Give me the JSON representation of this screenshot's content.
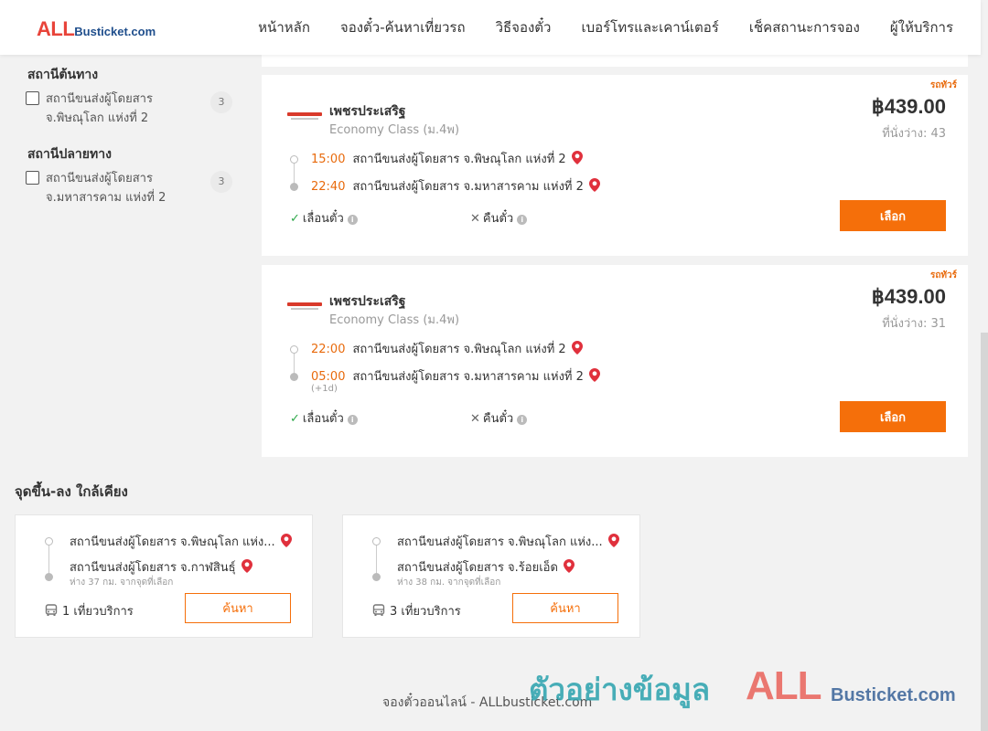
{
  "header": {
    "logo_all": "ALL",
    "logo_rest": "Busticket.com",
    "nav": [
      "หน้าหลัก",
      "จองตั๋ว-ค้นหาเที่ยวรถ",
      "วิธีจองตั๋ว",
      "เบอร์โทรและเคาน์เตอร์",
      "เช็คสถานะการจอง",
      "ผู้ให้บริการ"
    ]
  },
  "filters": {
    "origin_title": "สถานีต้นทาง",
    "origin_item": {
      "label": "สถานีขนส่งผู้โดยสาร จ.พิษณุโลก แห่งที่ 2",
      "count": "3"
    },
    "dest_title": "สถานีปลายทาง",
    "dest_item": {
      "label": "สถานีขนส่งผู้โดยสาร จ.มหาสารคาม แห่งที่ 2",
      "count": "3"
    }
  },
  "trips": [
    {
      "tag": "รถทัวร์",
      "operator": "เพชรประเสริฐ",
      "class": "Economy Class (ม.4พ)",
      "price": "฿439.00",
      "seats": "ที่นั่งว่าง: 43",
      "depart_time": "15:00",
      "depart_station": "สถานีขนส่งผู้โดยสาร จ.พิษณุโลก แห่งที่ 2",
      "arrive_time": "22:40",
      "arrive_station": "สถานีขนส่งผู้โดยสาร จ.มหาสารคาม แห่งที่ 2",
      "arrive_note": "",
      "feature_ok": "เลื่อนตั๋ว",
      "feature_no": "คืนตั๋ว",
      "button": "เลือก"
    },
    {
      "tag": "รถทัวร์",
      "operator": "เพชรประเสริฐ",
      "class": "Economy Class (ม.4พ)",
      "price": "฿439.00",
      "seats": "ที่นั่งว่าง: 31",
      "depart_time": "22:00",
      "depart_station": "สถานีขนส่งผู้โดยสาร จ.พิษณุโลก แห่งที่ 2",
      "arrive_time": "05:00",
      "arrive_station": "สถานีขนส่งผู้โดยสาร จ.มหาสารคาม แห่งที่ 2",
      "arrive_note": "(+1d)",
      "feature_ok": "เลื่อนตั๋ว",
      "feature_no": "คืนตั๋ว",
      "button": "เลือก"
    }
  ],
  "nearby": {
    "title": "จุดขึ้น-ลง ใกล้เคียง",
    "cards": [
      {
        "from": "สถานีขนส่งผู้โดยสาร จ.พิษณุโลก แห่ง...",
        "to": "สถานีขนส่งผู้โดยสาร จ.กาฬสินธุ์",
        "distance": "ห่าง 37 กม. จากจุดที่เลือก",
        "trips": "1 เที่ยวบริการ",
        "button": "ค้นหา"
      },
      {
        "from": "สถานีขนส่งผู้โดยสาร จ.พิษณุโลก แห่ง...",
        "to": "สถานีขนส่งผู้โดยสาร จ.ร้อยเอ็ด",
        "distance": "ห่าง 38 กม. จากจุดที่เลือก",
        "trips": "3 เที่ยวบริการ",
        "button": "ค้นหา"
      }
    ]
  },
  "footer": "จองตั๋วออนไลน์ - ALLbusticket.com",
  "watermark": {
    "text": "ตัวอย่างข้อมูล",
    "all": "ALL",
    "rest": "Busticket.com"
  },
  "colors": {
    "accent": "#f56f0a",
    "time": "#e86a0c",
    "pin": "#e0303c",
    "logo_red": "#e8443a",
    "logo_blue": "#1f4e8c",
    "check": "#2ea84a"
  },
  "icons": [
    "map-pin-icon",
    "check-icon",
    "x-icon",
    "info-icon",
    "bus-icon"
  ]
}
